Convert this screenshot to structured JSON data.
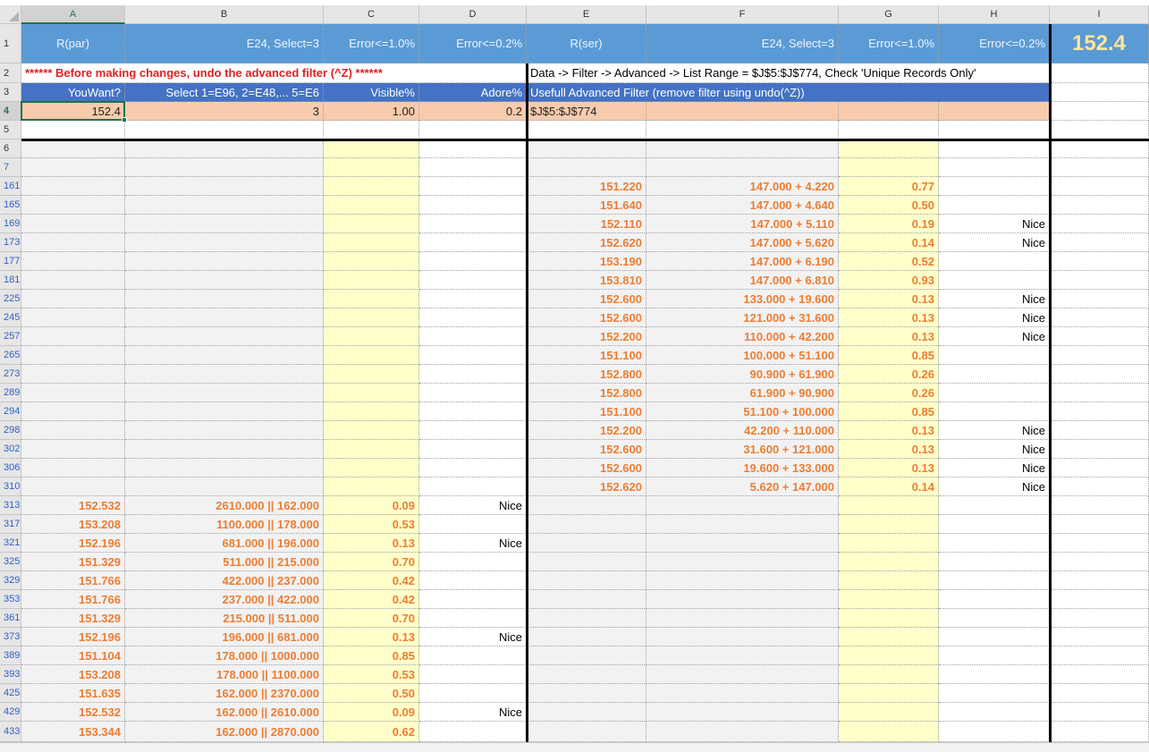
{
  "columns": [
    "A",
    "B",
    "C",
    "D",
    "E",
    "F",
    "G",
    "H",
    "I"
  ],
  "selected_column": "A",
  "selected_row": "4",
  "header_row": {
    "A": "R(par)",
    "B": "E24, Select=3",
    "C": "Error<=1.0%",
    "D": "Error<=0.2%",
    "E": "R(ser)",
    "F": "E24, Select=3",
    "G": "Error<=1.0%",
    "H": "Error<=0.2%",
    "I": "152.4"
  },
  "row2": {
    "warning": "****** Before making changes, undo the advanced filter (^Z) ******",
    "note": "Data -> Filter -> Advanced -> List Range = $J$5:$J$774, Check 'Unique Records Only'"
  },
  "row3": {
    "A": "YouWant?",
    "B": "Select 1=E96, 2=E48,... 5=E6",
    "C": "Visible%",
    "D": "Adore%",
    "E": "Usefull Advanced Filter (remove filter using undo(^Z))"
  },
  "row4": {
    "A": "152.4",
    "B": "3",
    "C": "1.00",
    "D": "0.2",
    "E": "$J$5:$J$774"
  },
  "row_numbers": [
    "1",
    "2",
    "3",
    "4",
    "5",
    "6",
    "7",
    "161",
    "165",
    "169",
    "173",
    "177",
    "181",
    "225",
    "245",
    "257",
    "265",
    "273",
    "289",
    "294",
    "298",
    "302",
    "306",
    "310",
    "313",
    "317",
    "321",
    "325",
    "329",
    "353",
    "361",
    "373",
    "389",
    "393",
    "425",
    "429",
    "433"
  ],
  "series_rows": [
    {
      "row": "161",
      "E": "151.220",
      "F": "147.000 + 4.220",
      "G": "0.77",
      "H": ""
    },
    {
      "row": "165",
      "E": "151.640",
      "F": "147.000 + 4.640",
      "G": "0.50",
      "H": ""
    },
    {
      "row": "169",
      "E": "152.110",
      "F": "147.000 + 5.110",
      "G": "0.19",
      "H": "Nice"
    },
    {
      "row": "173",
      "E": "152.620",
      "F": "147.000 + 5.620",
      "G": "0.14",
      "H": "Nice"
    },
    {
      "row": "177",
      "E": "153.190",
      "F": "147.000 + 6.190",
      "G": "0.52",
      "H": ""
    },
    {
      "row": "181",
      "E": "153.810",
      "F": "147.000 + 6.810",
      "G": "0.93",
      "H": ""
    },
    {
      "row": "225",
      "E": "152.600",
      "F": "133.000 + 19.600",
      "G": "0.13",
      "H": "Nice"
    },
    {
      "row": "245",
      "E": "152.600",
      "F": "121.000 + 31.600",
      "G": "0.13",
      "H": "Nice"
    },
    {
      "row": "257",
      "E": "152.200",
      "F": "110.000 + 42.200",
      "G": "0.13",
      "H": "Nice"
    },
    {
      "row": "265",
      "E": "151.100",
      "F": "100.000 + 51.100",
      "G": "0.85",
      "H": ""
    },
    {
      "row": "273",
      "E": "152.800",
      "F": "90.900 + 61.900",
      "G": "0.26",
      "H": ""
    },
    {
      "row": "289",
      "E": "152.800",
      "F": "61.900 + 90.900",
      "G": "0.26",
      "H": ""
    },
    {
      "row": "294",
      "E": "151.100",
      "F": "51.100 + 100.000",
      "G": "0.85",
      "H": ""
    },
    {
      "row": "298",
      "E": "152.200",
      "F": "42.200 + 110.000",
      "G": "0.13",
      "H": "Nice"
    },
    {
      "row": "302",
      "E": "152.600",
      "F": "31.600 + 121.000",
      "G": "0.13",
      "H": "Nice"
    },
    {
      "row": "306",
      "E": "152.600",
      "F": "19.600 + 133.000",
      "G": "0.13",
      "H": "Nice"
    },
    {
      "row": "310",
      "E": "152.620",
      "F": "5.620 + 147.000",
      "G": "0.14",
      "H": "Nice"
    }
  ],
  "parallel_rows": [
    {
      "row": "313",
      "A": "152.532",
      "B": "2610.000 || 162.000",
      "C": "0.09",
      "D": "Nice"
    },
    {
      "row": "317",
      "A": "153.208",
      "B": "1100.000 || 178.000",
      "C": "0.53",
      "D": ""
    },
    {
      "row": "321",
      "A": "152.196",
      "B": "681.000 || 196.000",
      "C": "0.13",
      "D": "Nice"
    },
    {
      "row": "325",
      "A": "151.329",
      "B": "511.000 || 215.000",
      "C": "0.70",
      "D": ""
    },
    {
      "row": "329",
      "A": "151.766",
      "B": "422.000 || 237.000",
      "C": "0.42",
      "D": ""
    },
    {
      "row": "353",
      "A": "151.766",
      "B": "237.000 || 422.000",
      "C": "0.42",
      "D": ""
    },
    {
      "row": "361",
      "A": "151.329",
      "B": "215.000 || 511.000",
      "C": "0.70",
      "D": ""
    },
    {
      "row": "373",
      "A": "152.196",
      "B": "196.000 || 681.000",
      "C": "0.13",
      "D": "Nice"
    },
    {
      "row": "389",
      "A": "151.104",
      "B": "178.000 || 1000.000",
      "C": "0.85",
      "D": ""
    },
    {
      "row": "393",
      "A": "153.208",
      "B": "178.000 || 1100.000",
      "C": "0.53",
      "D": ""
    },
    {
      "row": "425",
      "A": "151.635",
      "B": "162.000 || 2370.000",
      "C": "0.50",
      "D": ""
    },
    {
      "row": "429",
      "A": "152.532",
      "B": "162.000 || 2610.000",
      "C": "0.09",
      "D": "Nice"
    },
    {
      "row": "433",
      "A": "153.344",
      "B": "162.000 || 2870.000",
      "C": "0.62",
      "D": ""
    }
  ]
}
